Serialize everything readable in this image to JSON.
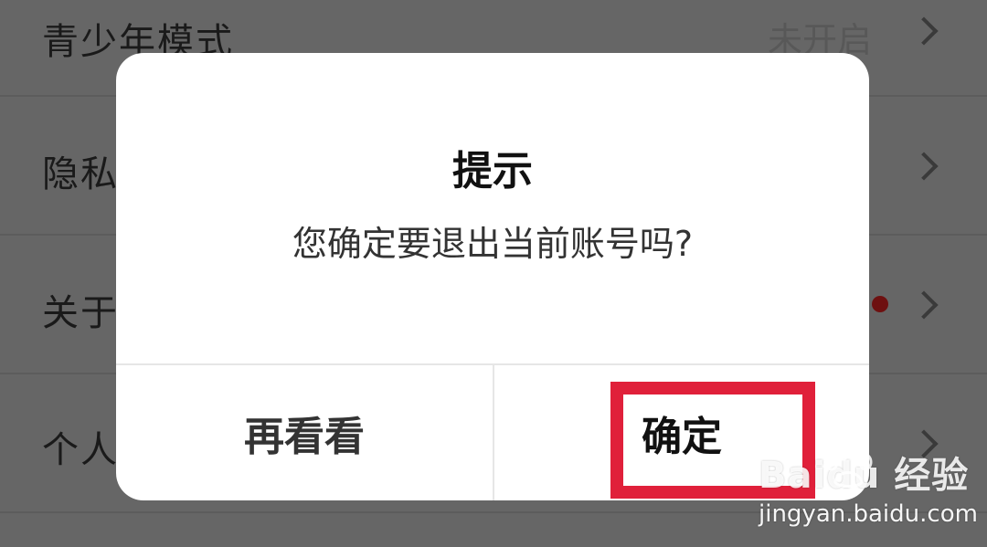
{
  "settings": {
    "rows": [
      {
        "label": "青少年模式",
        "value": "未开启"
      },
      {
        "label": "隐私",
        "value": ""
      },
      {
        "label": "关于",
        "value": ""
      },
      {
        "label": "个人",
        "value": ""
      }
    ]
  },
  "dialog": {
    "title": "提示",
    "message": "您确定要退出当前账号吗?",
    "cancel_label": "再看看",
    "confirm_label": "确定"
  },
  "watermark": {
    "logo_text": "Baidu 经验",
    "url": "jingyan.baidu.com"
  },
  "colors": {
    "overlay_background": "#666666",
    "highlight": "#e0203a",
    "notification_dot": "#6e1010"
  },
  "icons": {
    "chevron": "chevron-right-icon",
    "paw": "baidu-paw-icon"
  }
}
